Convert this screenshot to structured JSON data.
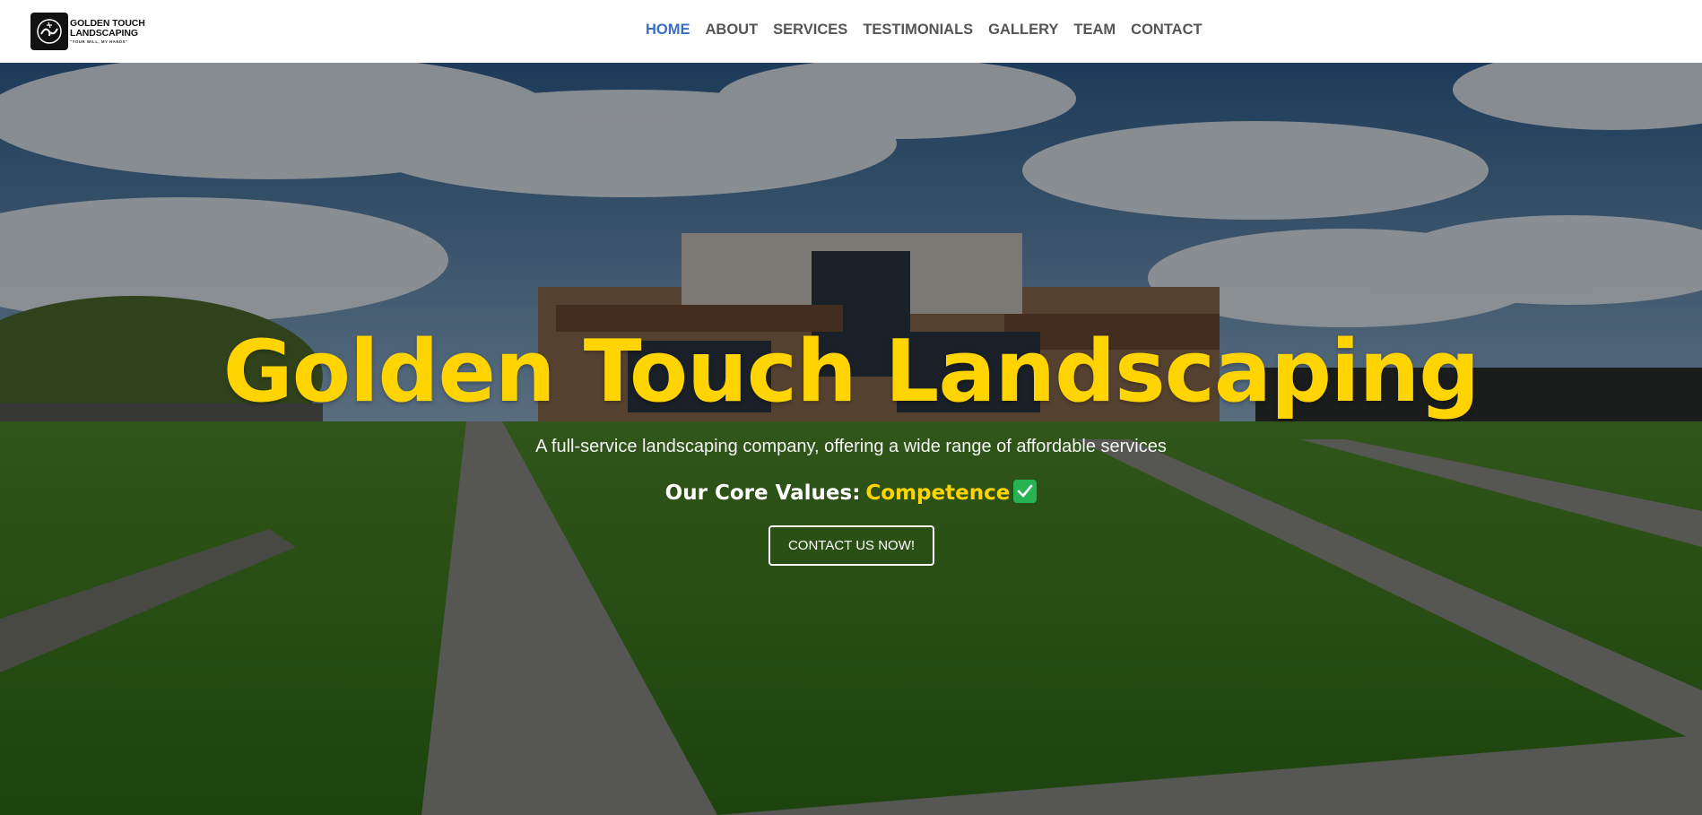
{
  "header": {
    "logo": {
      "line1": "GOLDEN TOUCH",
      "line2": "LANDSCAPING",
      "tagline": "\"YOUR WILL, MY HANDS\""
    },
    "nav": [
      {
        "label": "HOME",
        "active": true
      },
      {
        "label": "ABOUT",
        "active": false
      },
      {
        "label": "SERVICES",
        "active": false
      },
      {
        "label": "TESTIMONIALS",
        "active": false
      },
      {
        "label": "GALLERY",
        "active": false
      },
      {
        "label": "TEAM",
        "active": false
      },
      {
        "label": "CONTACT",
        "active": false
      }
    ]
  },
  "hero": {
    "title": "Golden Touch Landscaping",
    "subtitle": "A full-service landscaping company, offering a wide range of affordable services",
    "values_label": "Our Core Values:",
    "values_word": "Competence",
    "values_icon": "check-mark-icon",
    "cta_label": "CONTACT US NOW!"
  },
  "colors": {
    "accent_gold": "#ffd400",
    "nav_active": "#3a6fc4",
    "nav_default": "#555555",
    "check_green": "#27b351"
  }
}
